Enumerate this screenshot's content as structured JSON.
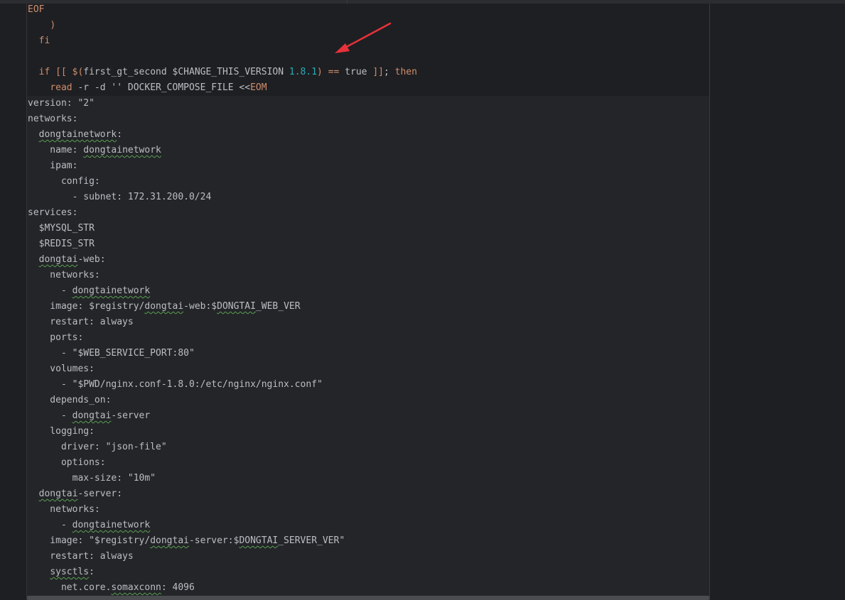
{
  "editor": {
    "accent_colors": {
      "keyword": "#cf8e6d",
      "string": "#6aab73",
      "number": "#2aacb8",
      "text": "#bcbec4",
      "annotation": "#e8313a",
      "spellcheck": "#5b9f52"
    },
    "lines": [
      [
        {
          "t": "EOF",
          "c": "k"
        }
      ],
      [
        {
          "t": "    "
        },
        {
          "t": ")",
          "c": "k"
        }
      ],
      [
        {
          "t": "  "
        },
        {
          "t": "fi",
          "c": "k"
        }
      ],
      [
        {
          "t": ""
        }
      ],
      [
        {
          "t": "  "
        },
        {
          "t": "if [[ $(",
          "c": "k"
        },
        {
          "t": "first_gt_second "
        },
        {
          "t": "$CHANGE_THIS_VERSION"
        },
        {
          "t": " "
        },
        {
          "t": "1.8.1",
          "c": "n"
        },
        {
          "t": ")",
          "c": "k"
        },
        {
          "t": " "
        },
        {
          "t": "==",
          "c": "k"
        },
        {
          "t": " true "
        },
        {
          "t": "]]",
          "c": "k"
        },
        {
          "t": "; "
        },
        {
          "t": "then",
          "c": "k"
        }
      ],
      [
        {
          "t": "    "
        },
        {
          "t": "read",
          "c": "k"
        },
        {
          "t": " -r -d '' DOCKER_COMPOSE_FILE <<"
        },
        {
          "t": "EOM",
          "c": "k"
        }
      ],
      [
        {
          "t": "version: \"2\""
        }
      ],
      [
        {
          "t": "networks:"
        }
      ],
      [
        {
          "t": "  "
        },
        {
          "t": "dongtainetwork",
          "w": true
        },
        {
          "t": ":"
        }
      ],
      [
        {
          "t": "    name: "
        },
        {
          "t": "dongtainetwork",
          "w": true
        }
      ],
      [
        {
          "t": "    ipam:"
        }
      ],
      [
        {
          "t": "      config:"
        }
      ],
      [
        {
          "t": "        - subnet: 172.31.200.0/24"
        }
      ],
      [
        {
          "t": "services:"
        }
      ],
      [
        {
          "t": "  $MYSQL_STR"
        }
      ],
      [
        {
          "t": "  $REDIS_STR"
        }
      ],
      [
        {
          "t": "  "
        },
        {
          "t": "dongtai",
          "w": true
        },
        {
          "t": "-web:"
        }
      ],
      [
        {
          "t": "    networks:"
        }
      ],
      [
        {
          "t": "      - "
        },
        {
          "t": "dongtainetwork",
          "w": true
        }
      ],
      [
        {
          "t": "    image: $registry/"
        },
        {
          "t": "dongtai",
          "w": true
        },
        {
          "t": "-web:$"
        },
        {
          "t": "DONGTAI",
          "w": true
        },
        {
          "t": "_WEB_VER"
        }
      ],
      [
        {
          "t": "    restart: always"
        }
      ],
      [
        {
          "t": "    ports:"
        }
      ],
      [
        {
          "t": "      - \"$WEB_SERVICE_PORT:80\""
        }
      ],
      [
        {
          "t": "    volumes:"
        }
      ],
      [
        {
          "t": "      - \"$PWD/nginx.conf-1.8.0:/etc/nginx/nginx.conf\""
        }
      ],
      [
        {
          "t": "    depends_on:"
        }
      ],
      [
        {
          "t": "      - "
        },
        {
          "t": "dongtai",
          "w": true
        },
        {
          "t": "-server"
        }
      ],
      [
        {
          "t": "    logging:"
        }
      ],
      [
        {
          "t": "      driver: \"json-file\""
        }
      ],
      [
        {
          "t": "      options:"
        }
      ],
      [
        {
          "t": "        max-size: \"10m\""
        }
      ],
      [
        {
          "t": "  "
        },
        {
          "t": "dongtai",
          "w": true
        },
        {
          "t": "-server:"
        }
      ],
      [
        {
          "t": "    networks:"
        }
      ],
      [
        {
          "t": "      - "
        },
        {
          "t": "dongtainetwork",
          "w": true
        }
      ],
      [
        {
          "t": "    image: \"$registry/"
        },
        {
          "t": "dongtai",
          "w": true
        },
        {
          "t": "-server:$"
        },
        {
          "t": "DONGTAI",
          "w": true
        },
        {
          "t": "_SERVER_VER\""
        }
      ],
      [
        {
          "t": "    restart: always"
        }
      ],
      [
        {
          "t": "    "
        },
        {
          "t": "sysctls",
          "w": true
        },
        {
          "t": ":"
        }
      ],
      [
        {
          "t": "      net.core."
        },
        {
          "t": "somaxconn",
          "w": true
        },
        {
          "t": ": 4096"
        }
      ]
    ]
  }
}
